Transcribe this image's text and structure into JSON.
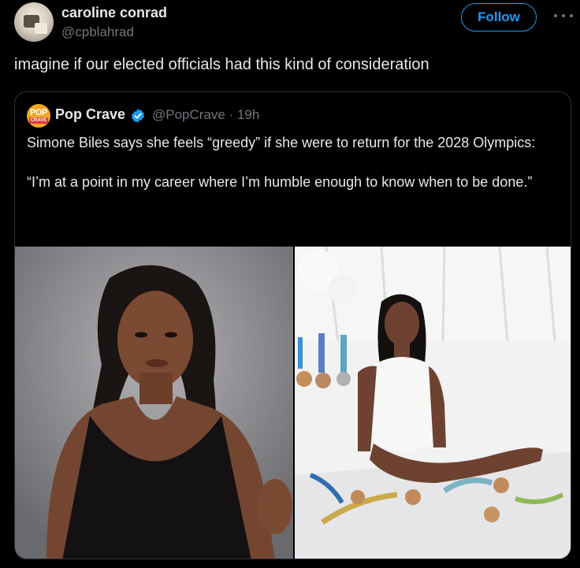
{
  "author": {
    "display_name": "caroline conrad",
    "handle": "@cpblahrad",
    "avatar_icon": "profile-photo"
  },
  "follow_label": "Follow",
  "more_icon": "more-horizontal-icon",
  "tweet_text": "imagine if our elected officials had this kind of consideration",
  "quote": {
    "display_name": "Pop Crave",
    "avatar_pop": "POP",
    "avatar_crave": "CRAVE",
    "verified_icon": "verified-badge-icon",
    "handle_time": "@PopCrave · 19h",
    "text_line1": "Simone Biles says she feels “greedy” if she were to return for the 2028 Olympics:",
    "text_line2": "“I’m at a point in my career where I’m humble enough to know when to be done.”"
  },
  "colors": {
    "background": "#000000",
    "text": "#e7e9ea",
    "secondary": "#71767b",
    "accent": "#1d9bf0",
    "border": "#2f3336"
  }
}
